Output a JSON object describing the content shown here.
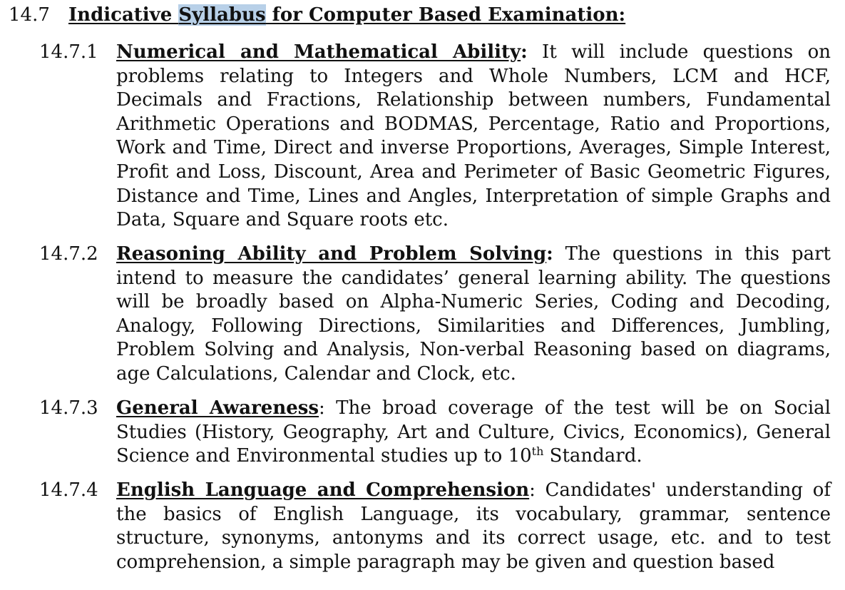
{
  "section": {
    "number": "14.7",
    "title_before": "Indicative ",
    "title_highlight": "Syllabus",
    "title_after": " for Computer Based Examination:"
  },
  "items": [
    {
      "number": "14.7.1",
      "lead": "Numerical and Mathematical Ability",
      "sep": ":",
      "text": " It will include questions on problems relating to Integers and Whole Numbers, LCM and HCF, Decimals and Fractions, Relationship between numbers, Fundamental Arithmetic Operations and BODMAS, Percentage, Ratio and Proportions, Work and Time, Direct and inverse Proportions, Averages, Simple Interest, Profit and Loss, Discount, Area and Perimeter of Basic Geometric Figures, Distance and Time, Lines and Angles, Interpretation of simple Graphs and Data, Square and Square roots etc."
    },
    {
      "number": "14.7.2",
      "lead": "Reasoning Ability and Problem Solving",
      "sep": ":",
      "text": " The questions in this part intend to measure the candidates’ general learning ability. The questions will be broadly based on Alpha-Numeric Series, Coding and Decoding, Analogy, Following Directions, Similarities and Differences, Jumbling, Problem Solving and Analysis, Non-verbal Reasoning based on diagrams, age Calculations, Calendar and Clock, etc."
    },
    {
      "number": "14.7.3",
      "lead": "General Awareness",
      "sep": ":",
      "text_before_sup": "  The broad coverage of the test will be on Social Studies (History, Geography, Art and Culture, Civics, Economics), General Science and Environmental studies up to 10",
      "sup": "th",
      "text_after_sup": " Standard."
    },
    {
      "number": "14.7.4",
      "lead": "English Language and Comprehension",
      "sep": ":",
      "text": " Candidates' understanding of the basics of English Language, its vocabulary, grammar, sentence structure, synonyms, antonyms and its correct usage, etc. and to test comprehension, a simple paragraph may be given and question based"
    }
  ]
}
